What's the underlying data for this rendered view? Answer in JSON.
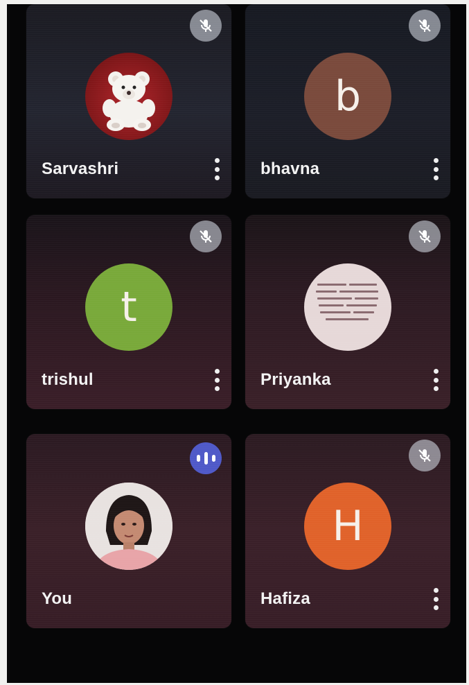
{
  "participants": [
    {
      "name": "Sarvashri",
      "avatar": "teddy-bear-photo",
      "status": "muted"
    },
    {
      "name": "bhavna",
      "initial": "b",
      "avatar_color": "#7a4a3c",
      "status": "muted"
    },
    {
      "name": "trishul",
      "initial": "t",
      "avatar_color": "#79a93a",
      "status": "muted"
    },
    {
      "name": "Priyanka",
      "avatar": "text-image-photo",
      "status": "muted"
    },
    {
      "name": "You",
      "avatar": "user-photo",
      "status": "speaking"
    },
    {
      "name": "Hafiza",
      "initial": "H",
      "avatar_color": "#e0622a",
      "status": "muted"
    }
  ],
  "icons": {
    "muted": "mic-off-icon",
    "speaking": "audio-level-icon",
    "more": "more-vertical-icon"
  },
  "colors": {
    "speaking_indicator": "#4f59c8",
    "mute_indicator": "#c8cdd7"
  }
}
